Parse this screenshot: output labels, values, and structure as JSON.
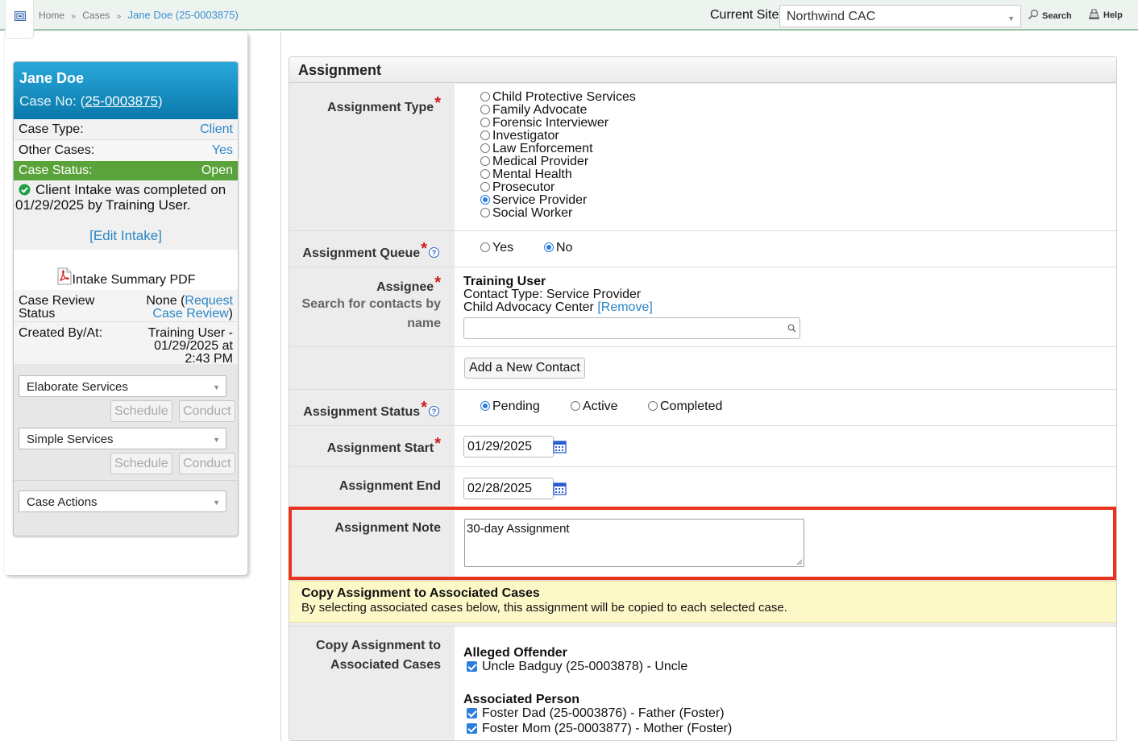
{
  "breadcrumb": {
    "home": "Home",
    "sep1": "»",
    "cases": "Cases",
    "sep2": "»",
    "current": "Jane Doe (25-0003875)"
  },
  "topbar": {
    "site_label": "Current Site",
    "site_value": "Northwind CAC",
    "search": "Search",
    "help": "Help"
  },
  "case": {
    "name": "Jane Doe",
    "caseno_prefix": "Case No: (",
    "caseno": "25-0003875",
    "caseno_suffix": ")",
    "case_type_label": "Case Type:",
    "case_type": "Client",
    "other_cases_label": "Other Cases:",
    "other_cases": "Yes",
    "status_label": "Case Status:",
    "status": "Open",
    "intake_msg": "Client Intake was completed on 01/29/2025 by Training User.",
    "edit_intake": "[Edit Intake]",
    "pdf_label": "Intake Summary PDF",
    "review_label": "Case Review Status",
    "review_none": "None (",
    "review_link": "Request Case Review",
    "review_close": ")",
    "created_label": "Created By/At:",
    "created_value": "Training User - 01/29/2025 at 2:43 PM",
    "services": [
      {
        "select": "Elaborate Services",
        "schedule": "Schedule",
        "conduct": "Conduct"
      },
      {
        "select": "Simple Services",
        "schedule": "Schedule",
        "conduct": "Conduct"
      }
    ],
    "case_actions": "Case Actions"
  },
  "form": {
    "title": "Assignment",
    "type_label": "Assignment Type",
    "types": [
      "Child Protective Services",
      "Family Advocate",
      "Forensic Interviewer",
      "Investigator",
      "Law Enforcement",
      "Medical Provider",
      "Mental Health",
      "Prosecutor",
      "Service Provider",
      "Social Worker"
    ],
    "type_selected": "Service Provider",
    "queue_label": "Assignment Queue",
    "queue_yes": "Yes",
    "queue_no": "No",
    "assignee_label": "Assignee",
    "assignee_hint": "Search for contacts by name",
    "assignee_name": "Training User",
    "assignee_type": "Contact Type: Service Provider",
    "assignee_org": "Child Advocacy Center",
    "remove": "[Remove]",
    "add_contact": "Add a New Contact",
    "status_label": "Assignment Status",
    "status_pending": "Pending",
    "status_active": "Active",
    "status_completed": "Completed",
    "start_label": "Assignment Start",
    "start_value": "01/29/2025",
    "end_label": "Assignment End",
    "end_value": "02/28/2025",
    "note_label": "Assignment Note",
    "note_value": "30-day Assignment",
    "copy_title": "Copy Assignment to Associated Cases",
    "copy_desc": "By selecting associated cases below, this assignment will be copied to each selected case.",
    "copy_label": "Copy Assignment to Associated Cases",
    "offender_title": "Alleged Offender",
    "offender_items": [
      "Uncle Badguy (25-0003878) - Uncle"
    ],
    "person_title": "Associated Person",
    "person_items": [
      "Foster Dad (25-0003876) - Father (Foster)",
      "Foster Mom (25-0003877) - Mother (Foster)"
    ]
  },
  "colors": {
    "accent_link": "#2a86c5",
    "status_open": "#5aa33a",
    "header_blue": "#0a78aa",
    "highlight": "#e8341c",
    "required": "#d01818"
  }
}
